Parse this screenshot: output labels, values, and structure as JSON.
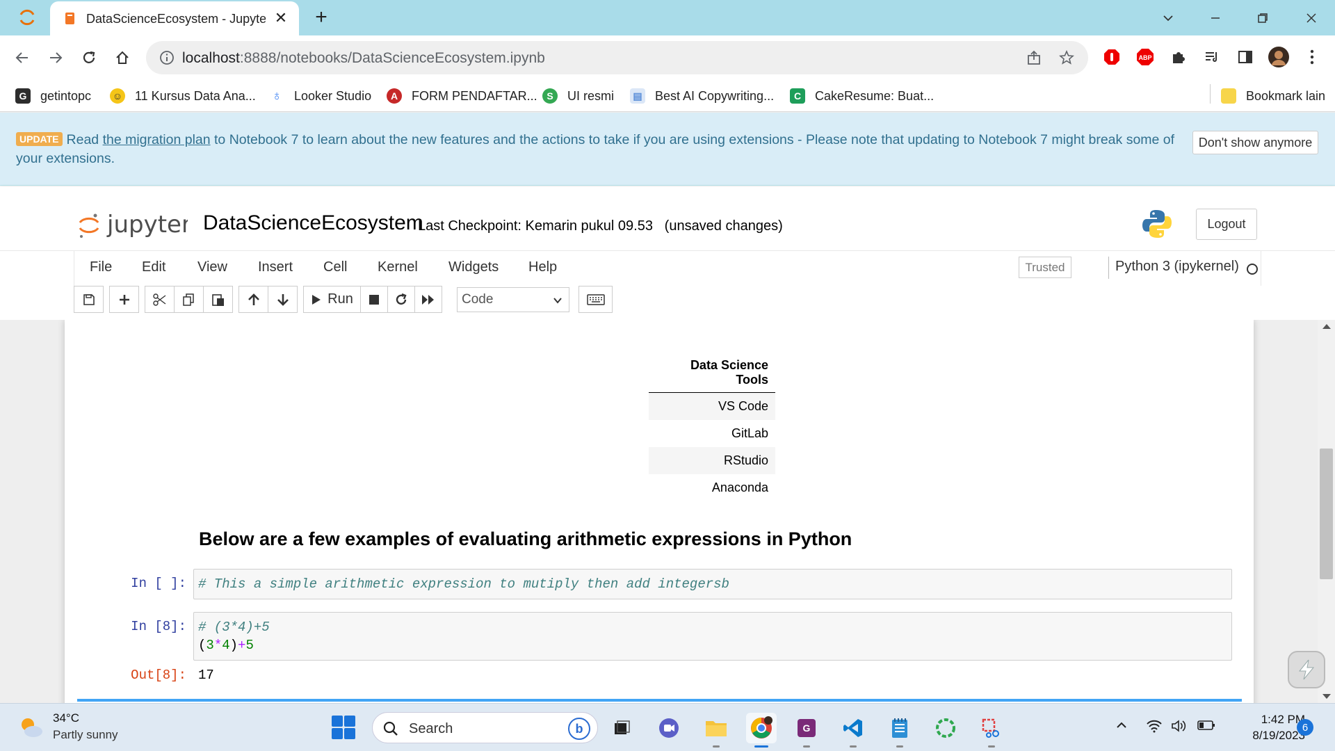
{
  "browser": {
    "tab_title": "DataScienceEcosystem - Jupyter N",
    "tab_close": "✕",
    "new_tab": "+",
    "url_host": "localhost",
    "url_path": ":8888/notebooks/DataScienceEcosystem.ipynb",
    "bookmarks": [
      {
        "label": "getintopc",
        "icon": "g-icon",
        "color": "#2d2d2d"
      },
      {
        "label": "11 Kursus Data Ana...",
        "icon": "emoji-icon",
        "color": "#f5c518"
      },
      {
        "label": "Looker Studio",
        "icon": "looker-icon",
        "color": "#4285f4"
      },
      {
        "label": "FORM PENDAFTAR...",
        "icon": "form-icon",
        "color": "#c62828"
      },
      {
        "label": "UI resmi",
        "icon": "s-icon",
        "color": "#34a853"
      },
      {
        "label": "Best AI Copywriting...",
        "icon": "doc-icon",
        "color": "#5b8fd9"
      },
      {
        "label": "CakeResume: Buat...",
        "icon": "c-icon",
        "color": "#1e9e5a"
      }
    ],
    "other_bookmarks": "Bookmark lain"
  },
  "banner": {
    "badge": "UPDATE",
    "text_before": "Read ",
    "link": "the migration plan",
    "text_after": " to Notebook 7 to learn about the new features and the actions to take if you are using extensions - Please note that updating to Notebook 7 might break some of your extensions.",
    "dismiss": "Don't show anymore"
  },
  "header": {
    "logo_text": "jupyter",
    "notebook_name": "DataScienceEcosystem",
    "checkpoint": "Last Checkpoint: Kemarin pukul 09.53",
    "unsaved": "(unsaved changes)",
    "logout": "Logout"
  },
  "menu": {
    "items": [
      "File",
      "Edit",
      "View",
      "Insert",
      "Cell",
      "Kernel",
      "Widgets",
      "Help"
    ],
    "trusted": "Trusted",
    "kernel": "Python 3 (ipykernel)"
  },
  "toolbar": {
    "run_label": "Run",
    "cell_type": "Code"
  },
  "notebook": {
    "table": {
      "header": "Data Science Tools",
      "rows": [
        "VS Code",
        "GitLab",
        "RStudio",
        "Anaconda"
      ]
    },
    "heading": "Below are a few examples of evaluating arithmetic expressions in Python",
    "cells": [
      {
        "prompt": "In [ ]:",
        "line1": "# This a simple arithmetic expression to mutiply then add integersb"
      },
      {
        "prompt": "In [8]:",
        "line1": "# (3*4)+5",
        "code_open": "(",
        "n1": "3",
        "op1": "*",
        "n2": "4",
        "code_close": ")",
        "op2": "+",
        "n3": "5"
      }
    ],
    "output": {
      "prompt": "Out[8]:",
      "value": "17"
    }
  },
  "taskbar": {
    "temperature": "34°C",
    "weather": "Partly sunny",
    "search": "Search",
    "time": "1:42 PM",
    "date": "8/19/2023",
    "notifications": "6"
  }
}
